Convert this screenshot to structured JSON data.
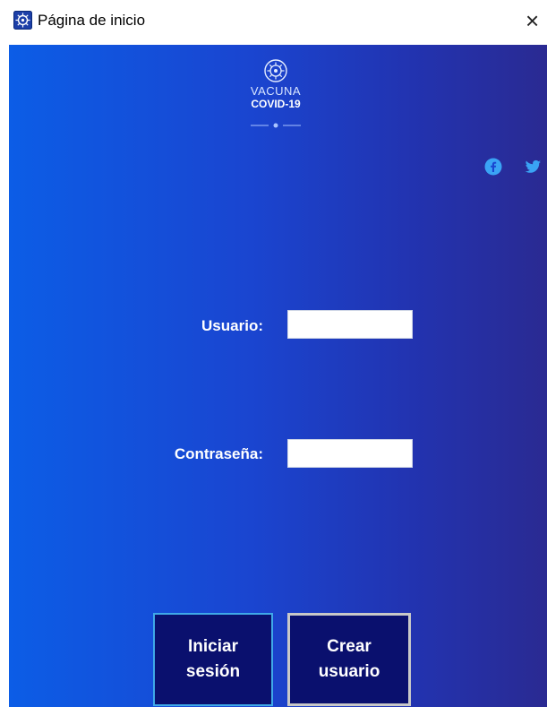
{
  "window": {
    "title": "Página de inicio",
    "close_glyph": "×",
    "app_icon": "covid-vaccine-icon"
  },
  "logo": {
    "line1": "VACUNA",
    "line2": "COVID-19",
    "emblem_icon": "virus-icon"
  },
  "social": {
    "facebook_icon": "facebook-icon",
    "twitter_icon": "twitter-icon",
    "icon_color": "#3aa3f5"
  },
  "form": {
    "user_label": "Usuario:",
    "user_value": "",
    "password_label": "Contraseña:",
    "password_value": ""
  },
  "buttons": {
    "login_label": "Iniciar\nsesión",
    "create_label": "Crear\nusuario"
  },
  "colors": {
    "gradient_start": "#0c5de6",
    "gradient_end": "#2a2a92",
    "button_bg": "#0a106e",
    "login_border": "#3fa9e8",
    "create_border": "#c8c8c8"
  }
}
